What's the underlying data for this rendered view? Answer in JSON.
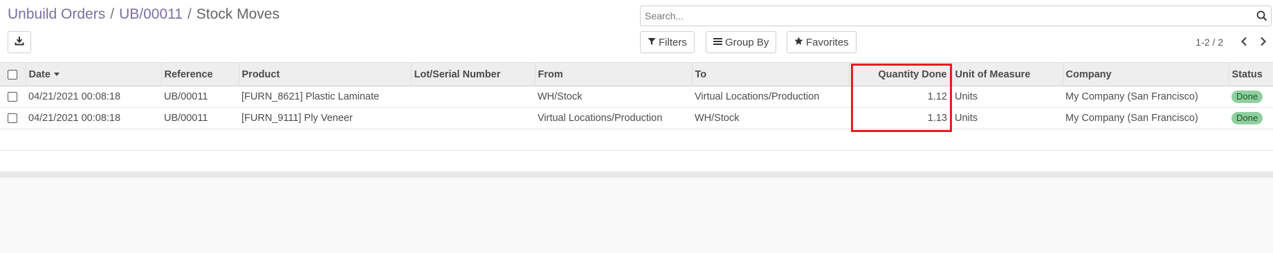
{
  "breadcrumb": {
    "items": [
      "Unbuild Orders",
      "UB/00011"
    ],
    "separator": "/",
    "current": "Stock Moves"
  },
  "search": {
    "placeholder": "Search...",
    "value": ""
  },
  "toolbar": {
    "filters_label": "Filters",
    "group_by_label": "Group By",
    "favorites_label": "Favorites"
  },
  "pager": {
    "value": "1-2 / 2"
  },
  "table": {
    "columns": [
      "Date",
      "Reference",
      "Product",
      "Lot/Serial Number",
      "From",
      "To",
      "Quantity Done",
      "Unit of Measure",
      "Company",
      "Status"
    ],
    "rows": [
      {
        "date": "04/21/2021 00:08:18",
        "reference": "UB/00011",
        "product": "[FURN_8621] Plastic Laminate",
        "lot": "",
        "from": "WH/Stock",
        "to": "Virtual Locations/Production",
        "quantity": "1.12",
        "uom": "Units",
        "company": "My Company (San Francisco)",
        "status": "Done"
      },
      {
        "date": "04/21/2021 00:08:18",
        "reference": "UB/00011",
        "product": "[FURN_9111] Ply Veneer",
        "lot": "",
        "from": "Virtual Locations/Production",
        "to": "WH/Stock",
        "quantity": "1.13",
        "uom": "Units",
        "company": "My Company (San Francisco)",
        "status": "Done"
      }
    ]
  },
  "colors": {
    "breadcrumb_link": "#7c6fa3",
    "status_done_bg": "#8ecf9e",
    "header_bg": "#eeeeee",
    "highlight": "#e02020"
  }
}
